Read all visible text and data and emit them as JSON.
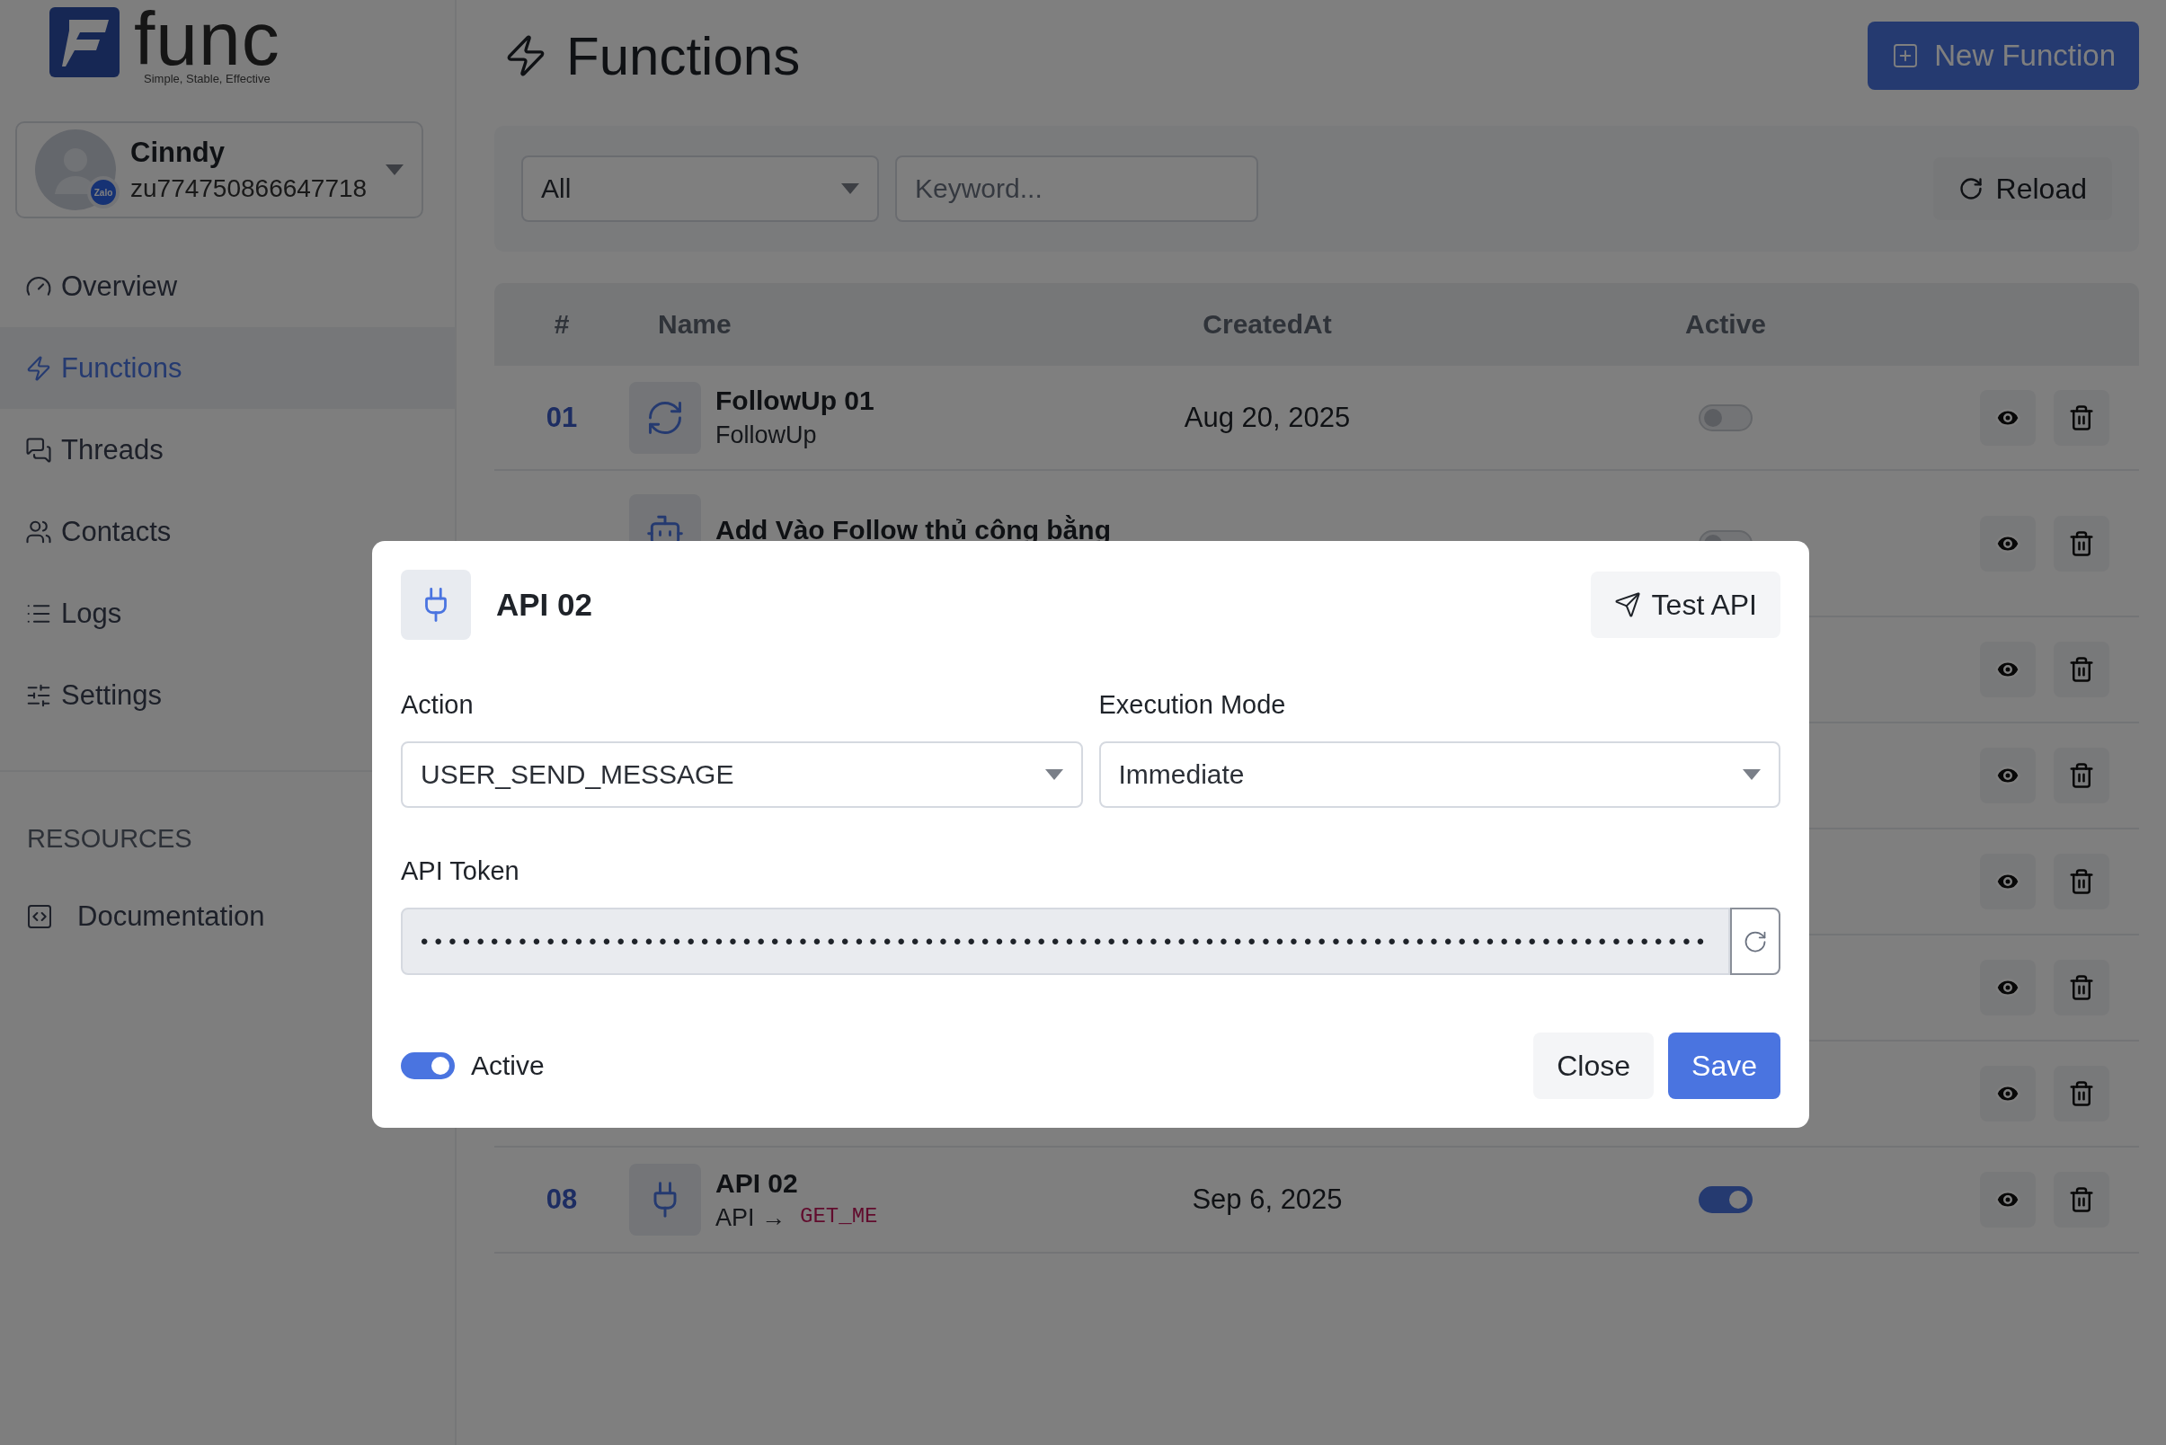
{
  "logo": {
    "name": "func",
    "tagline": "Simple, Stable, Effective"
  },
  "account": {
    "name": "Cinndy",
    "id": "zu774750866647718",
    "badge": "Zalo"
  },
  "nav": [
    {
      "label": "Overview",
      "selected": false
    },
    {
      "label": "Functions",
      "selected": true
    },
    {
      "label": "Threads",
      "selected": false
    },
    {
      "label": "Contacts",
      "selected": false
    },
    {
      "label": "Logs",
      "selected": false
    },
    {
      "label": "Settings",
      "selected": false
    }
  ],
  "resources": {
    "heading": "RESOURCES",
    "items": [
      {
        "label": "Documentation"
      }
    ]
  },
  "page": {
    "title": "Functions",
    "new_button": "New Function"
  },
  "filter": {
    "type": "All",
    "keyword_placeholder": "Keyword...",
    "reload": "Reload"
  },
  "table": {
    "columns": [
      "#",
      "Name",
      "CreatedAt",
      "Active"
    ],
    "rows": [
      {
        "kind": "full",
        "number": "01",
        "name": "FollowUp 01",
        "subtitle": "FollowUp",
        "created": "Aug 20, 2025",
        "active": false
      },
      {
        "kind": "tall",
        "name": "Add Vào Follow thủ công bằng",
        "active": false
      },
      {
        "kind": "actions_only"
      },
      {
        "kind": "actions_only"
      },
      {
        "kind": "actions_only"
      },
      {
        "kind": "actions_only"
      },
      {
        "kind": "actions_only"
      },
      {
        "kind": "full",
        "number": "08",
        "name": "API 02",
        "subtitle": "API →",
        "code": "GET_ME",
        "created": "Sep 6, 2025",
        "active": true
      }
    ]
  },
  "modal": {
    "title": "API 02",
    "test_button": "Test API",
    "fields": [
      {
        "label": "Action",
        "value": "USER_SEND_MESSAGE"
      },
      {
        "label": "Execution Mode",
        "value": "Immediate"
      }
    ],
    "token": {
      "label": "API Token",
      "value": "••••••••••••••••••••••••••••••••••••••••••••••••••••••••••••••••••••••••••••••••••••••••••••"
    },
    "active": {
      "label": "Active",
      "on": true
    },
    "buttons": {
      "close": "Close",
      "save": "Save"
    }
  }
}
